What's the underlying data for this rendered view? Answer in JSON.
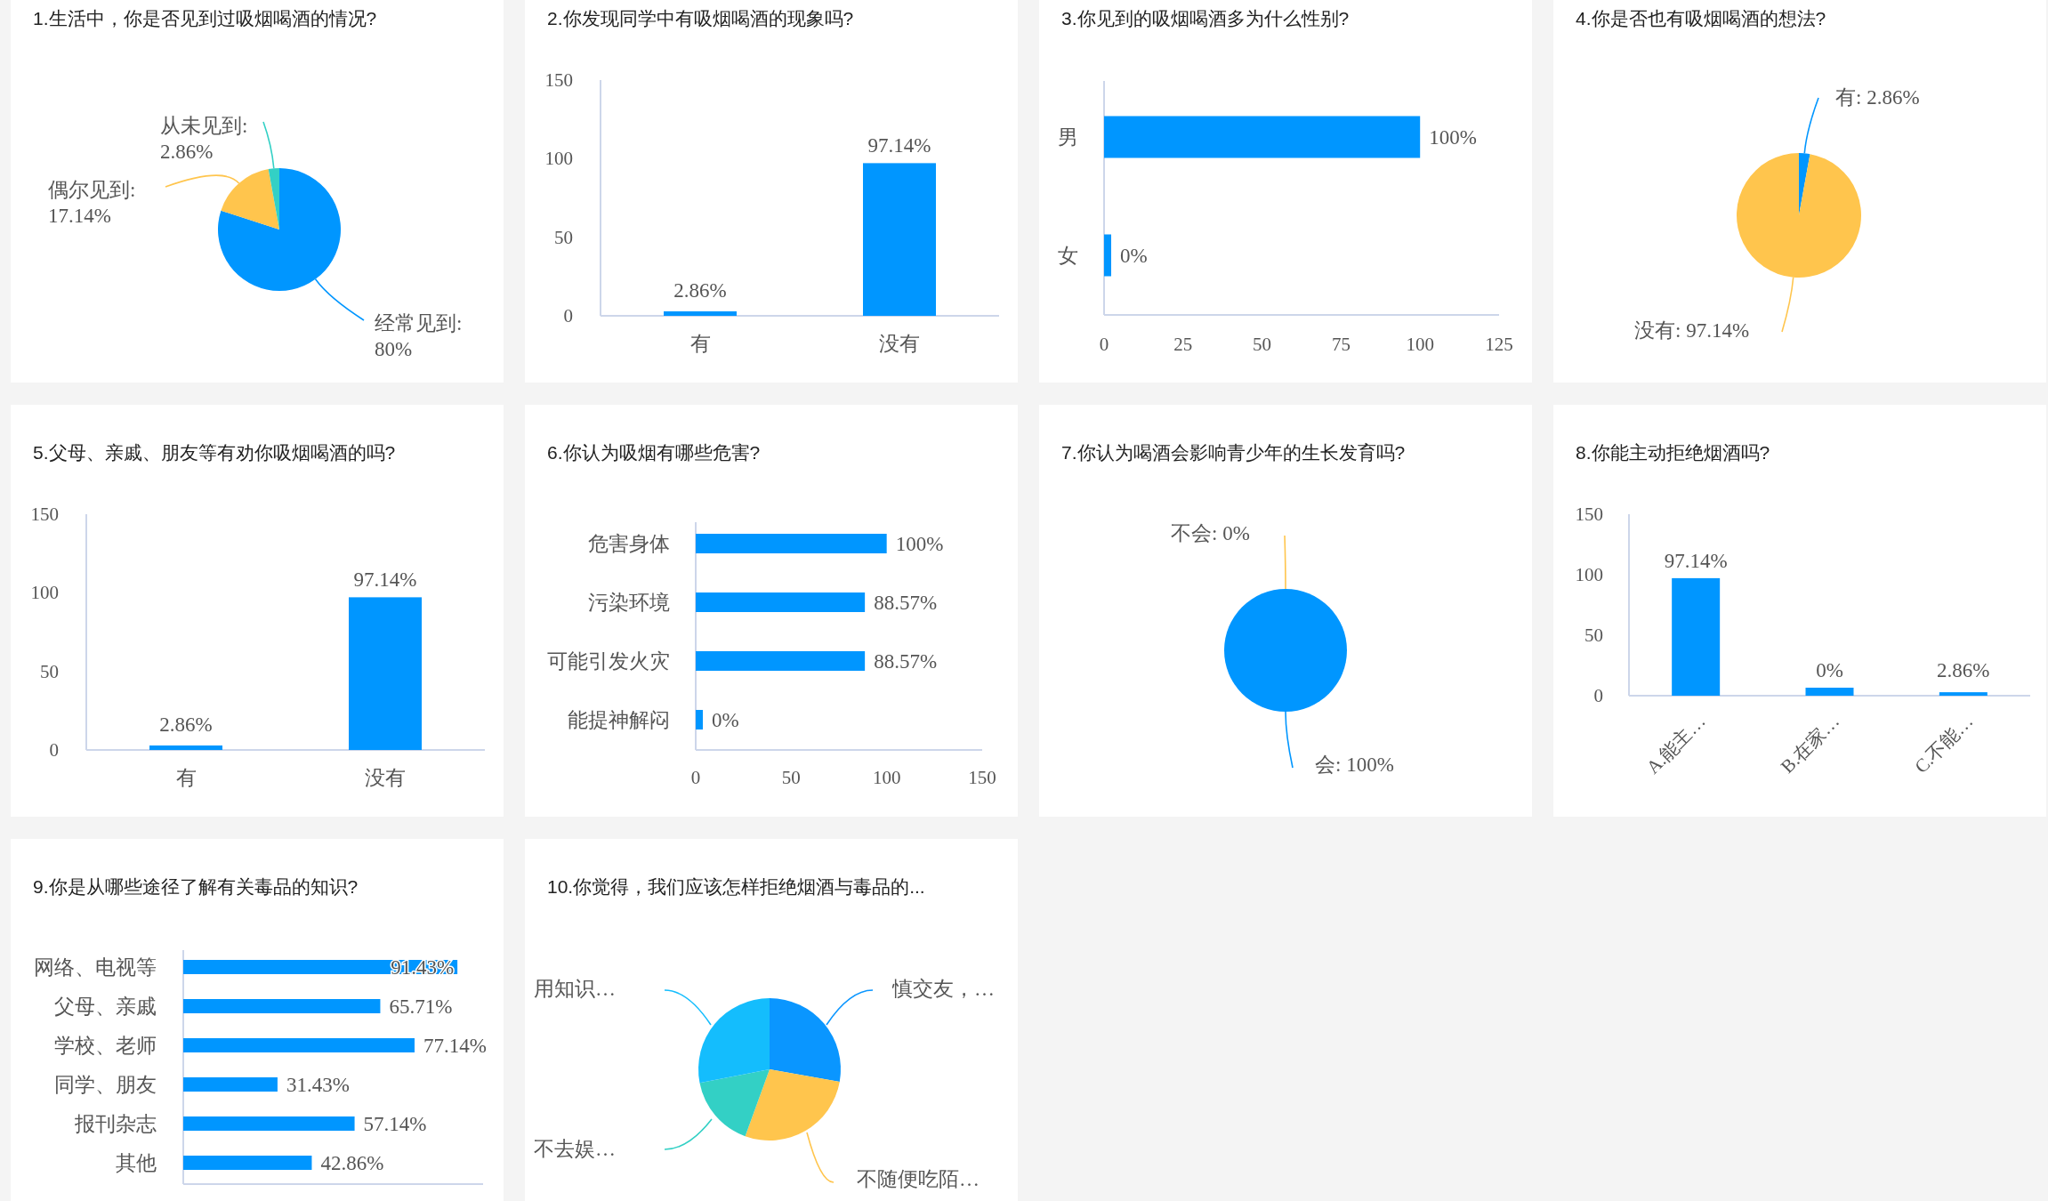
{
  "cards": [
    {
      "title": "1.生活中，你是否见到过吸烟喝酒的情况?",
      "chart_data": {
        "type": "pie",
        "categories": [
          "经常见到: 80%",
          "偶尔见到: 17.14%",
          "从未见到: 2.86%"
        ],
        "values": [
          80,
          17.14,
          2.86
        ],
        "colors": [
          "#0096ff",
          "#ffc54d",
          "#33d0c5"
        ]
      }
    },
    {
      "title": "2.你发现同学中有吸烟喝酒的现象吗?",
      "chart_data": {
        "type": "bar",
        "categories": [
          "有",
          "没有"
        ],
        "values": [
          2.86,
          97.14
        ],
        "value_labels": [
          "2.86%",
          "97.14%"
        ],
        "ylim": [
          0,
          150
        ],
        "yticks": [
          0,
          50,
          100,
          150
        ]
      }
    },
    {
      "title": "3.你见到的吸烟喝酒多为什么性别?",
      "chart_data": {
        "type": "bar",
        "orientation": "horizontal",
        "categories": [
          "男",
          "女"
        ],
        "values": [
          100,
          0
        ],
        "value_labels": [
          "100%",
          "0%"
        ],
        "xlim": [
          0,
          125
        ],
        "xticks": [
          0,
          25,
          50,
          75,
          100,
          125
        ]
      }
    },
    {
      "title": "4.你是否也有吸烟喝酒的想法?",
      "chart_data": {
        "type": "pie",
        "categories": [
          "有: 2.86%",
          "没有: 97.14%"
        ],
        "values": [
          2.86,
          97.14
        ],
        "colors": [
          "#0096ff",
          "#ffc54d"
        ]
      }
    },
    {
      "title": "5.父母、亲戚、朋友等有劝你吸烟喝酒的吗?",
      "chart_data": {
        "type": "bar",
        "categories": [
          "有",
          "没有"
        ],
        "values": [
          2.86,
          97.14
        ],
        "value_labels": [
          "2.86%",
          "97.14%"
        ],
        "ylim": [
          0,
          150
        ],
        "yticks": [
          0,
          50,
          100,
          150
        ]
      }
    },
    {
      "title": "6.你认为吸烟有哪些危害?",
      "chart_data": {
        "type": "bar",
        "orientation": "horizontal",
        "categories": [
          "危害身体",
          "污染环境",
          "可能引发火灾",
          "能提神解闷"
        ],
        "values": [
          100,
          88.57,
          88.57,
          0
        ],
        "value_labels": [
          "100%",
          "88.57%",
          "88.57%",
          "0%"
        ],
        "xlim": [
          0,
          150
        ],
        "xticks": [
          0,
          50,
          100,
          150
        ]
      }
    },
    {
      "title": "7.你认为喝酒会影响青少年的生长发育吗?",
      "chart_data": {
        "type": "pie",
        "categories": [
          "不会: 0%",
          "会: 100%"
        ],
        "values": [
          0,
          100
        ],
        "colors": [
          "#ffc54d",
          "#0096ff"
        ]
      }
    },
    {
      "title": "8.你能主动拒绝烟酒吗?",
      "chart_data": {
        "type": "bar",
        "categories": [
          "A.能主…",
          "B.在家…",
          "C.不能…"
        ],
        "values": [
          97.14,
          0,
          2.86
        ],
        "value_labels": [
          "97.14%",
          "0%",
          "2.86%"
        ],
        "ylim": [
          0,
          150
        ],
        "yticks": [
          0,
          50,
          100,
          150
        ]
      }
    },
    {
      "title": "9.你是从哪些途径了解有关毒品的知识?",
      "chart_data": {
        "type": "bar",
        "orientation": "horizontal",
        "categories": [
          "网络、电视等",
          "父母、亲戚",
          "学校、老师",
          "同学、朋友",
          "报刊杂志",
          "其他"
        ],
        "values": [
          91.43,
          65.71,
          77.14,
          31.43,
          57.14,
          42.86
        ],
        "value_labels": [
          "91.43%",
          "65.71%",
          "77.14%",
          "31.43%",
          "57.14%",
          "42.86%"
        ],
        "xlim": [
          0,
          100
        ]
      }
    },
    {
      "title": "10.你觉得，我们应该怎样拒绝烟酒与毒品的...",
      "labels": [
        "用知识…",
        "慎交友，…",
        "不去娱…",
        "不随便吃陌…"
      ]
    }
  ]
}
